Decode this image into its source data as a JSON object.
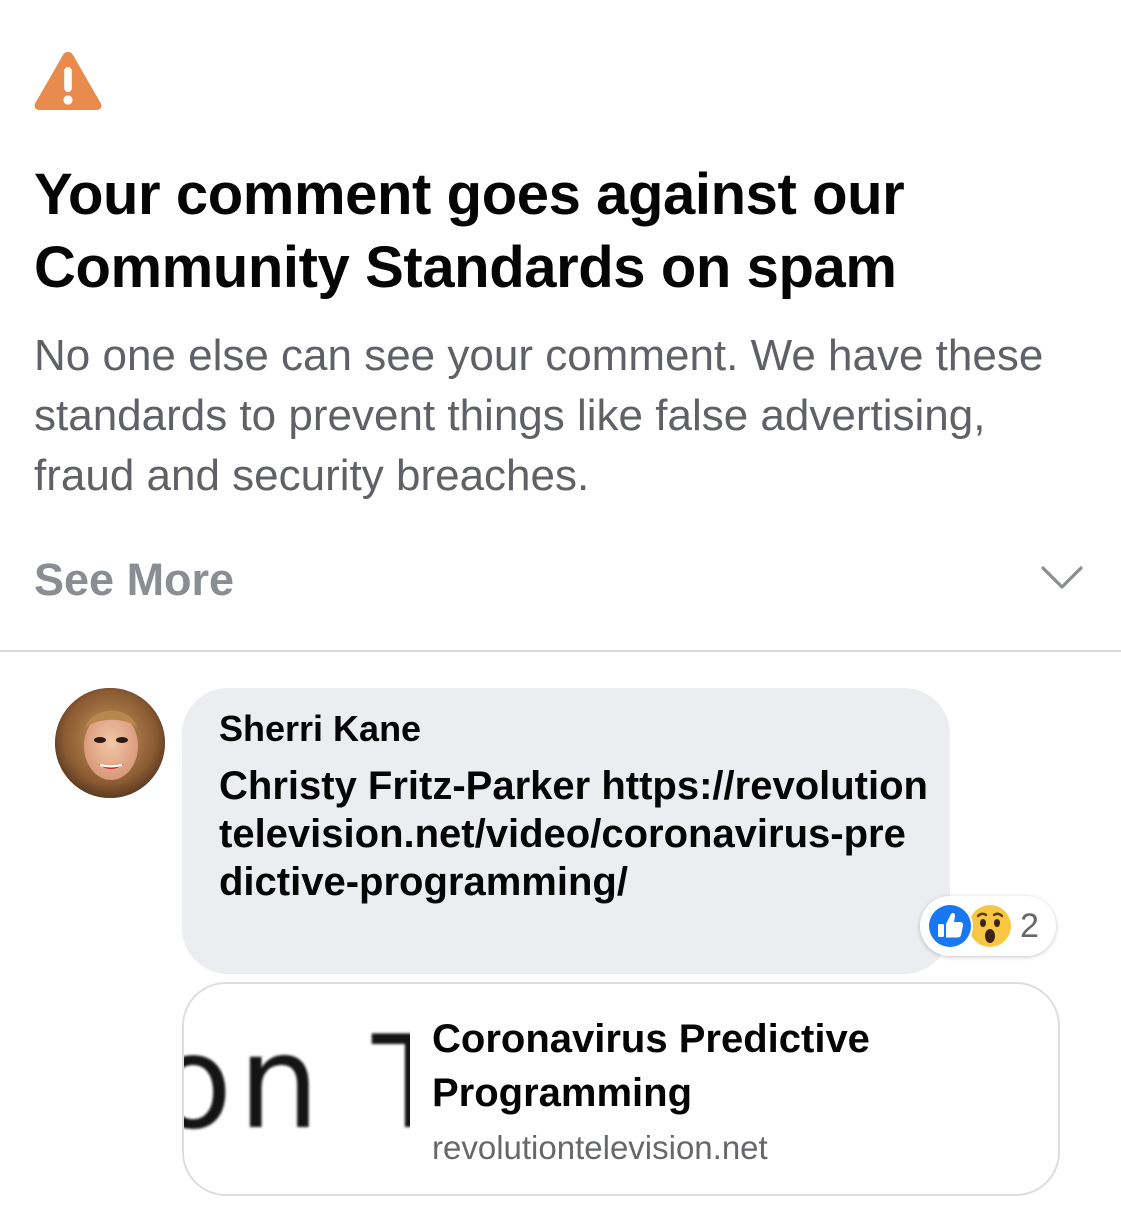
{
  "notice": {
    "icon": "warning-triangle-icon",
    "icon_color": "#E88B4C",
    "title": "Your comment goes against our Community Standards on spam",
    "body": "No one else can see your comment. We have these standards to prevent things like false advertising, fraud and security breaches.",
    "see_more_label": "See More",
    "chevron_icon": "chevron-down-icon"
  },
  "comment": {
    "author": "Sherri Kane",
    "text": "Christy Fritz-Parker https://revolutiontelevision.net/video/coronavirus-predictive-programming/",
    "bubble_color": "#EBEDF0",
    "reactions": {
      "icons": [
        "like-icon",
        "wow-icon"
      ],
      "like_color": "#1877F2",
      "count": "2"
    }
  },
  "link_preview": {
    "thumbnail_text": "on T",
    "title": "Coronavirus Predictive Programming",
    "domain": "revolutiontelevision.net"
  }
}
